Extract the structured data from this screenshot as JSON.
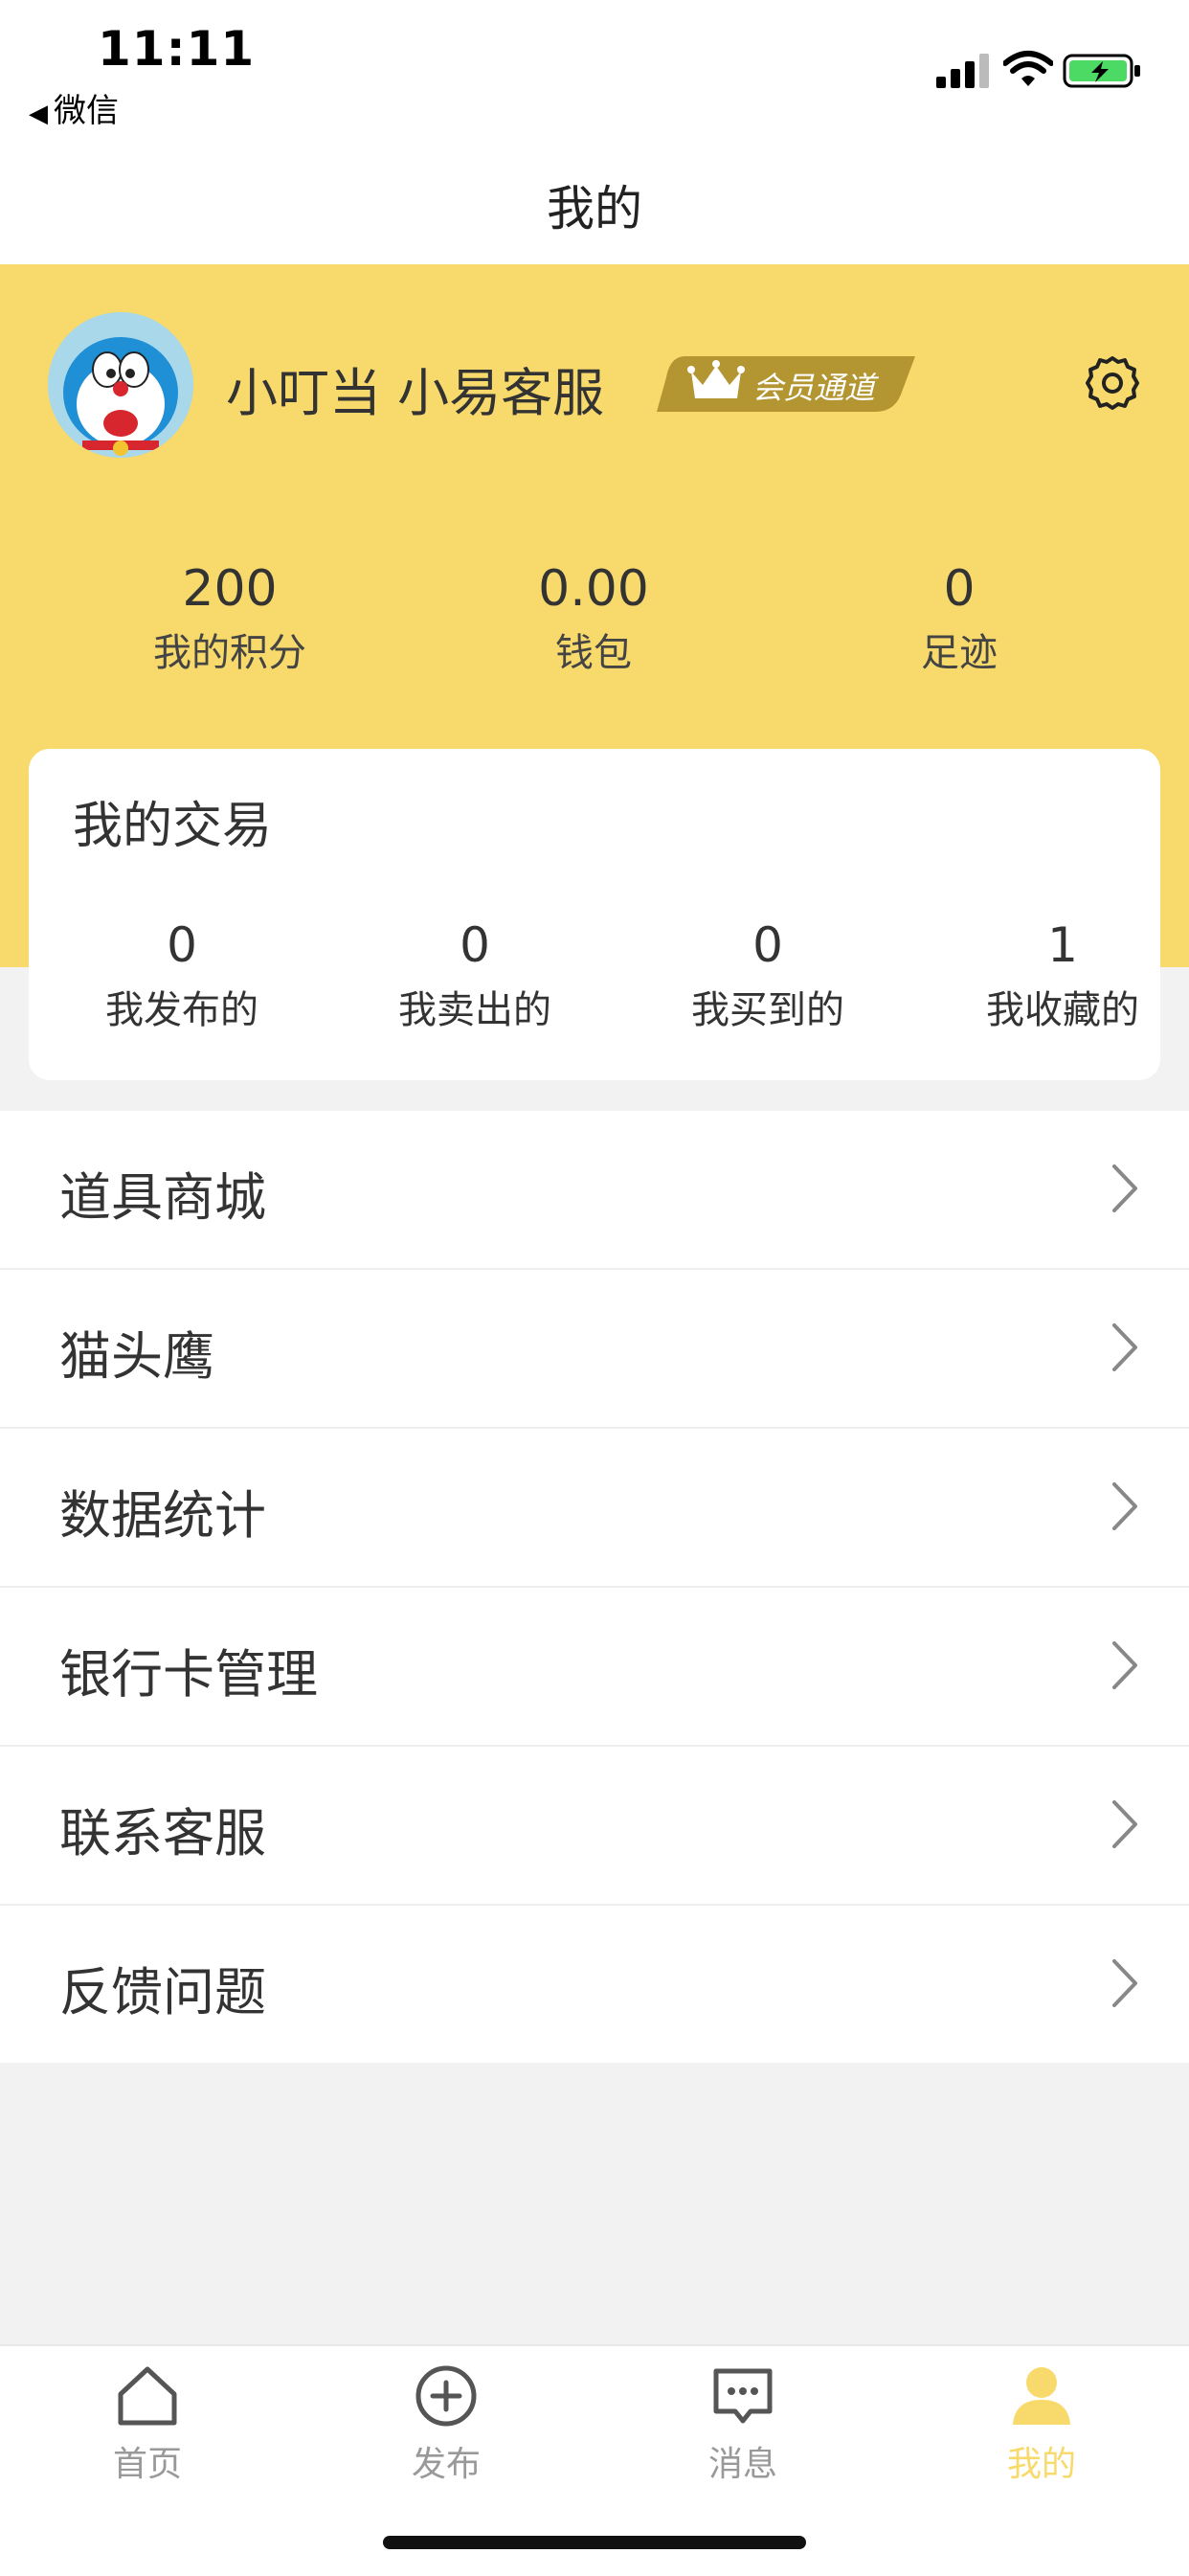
{
  "status_bar": {
    "time": "11:11",
    "back_label": "微信"
  },
  "nav": {
    "title": "我的"
  },
  "profile": {
    "username": "小叮当  小易客服",
    "vip_label": "会员通道"
  },
  "stats": [
    {
      "value": "200",
      "label": "我的积分"
    },
    {
      "value": "0.00",
      "label": "钱包"
    },
    {
      "value": "0",
      "label": "足迹"
    }
  ],
  "trade": {
    "title": "我的交易",
    "items": [
      {
        "value": "0",
        "label": "我发布的"
      },
      {
        "value": "0",
        "label": "我卖出的"
      },
      {
        "value": "0",
        "label": "我买到的"
      },
      {
        "value": "1",
        "label": "我收藏的"
      }
    ]
  },
  "menu": [
    {
      "label": "道具商城"
    },
    {
      "label": "猫头鹰"
    },
    {
      "label": "数据统计"
    },
    {
      "label": "银行卡管理"
    },
    {
      "label": "联系客服"
    },
    {
      "label": "反馈问题"
    }
  ],
  "tabs": [
    {
      "label": "首页",
      "icon": "home-icon"
    },
    {
      "label": "发布",
      "icon": "plus-circle-icon"
    },
    {
      "label": "消息",
      "icon": "message-icon"
    },
    {
      "label": "我的",
      "icon": "user-icon"
    }
  ],
  "colors": {
    "accent": "#f8da6c",
    "vip_badge": "#b39532",
    "background": "#f2f2f2"
  }
}
